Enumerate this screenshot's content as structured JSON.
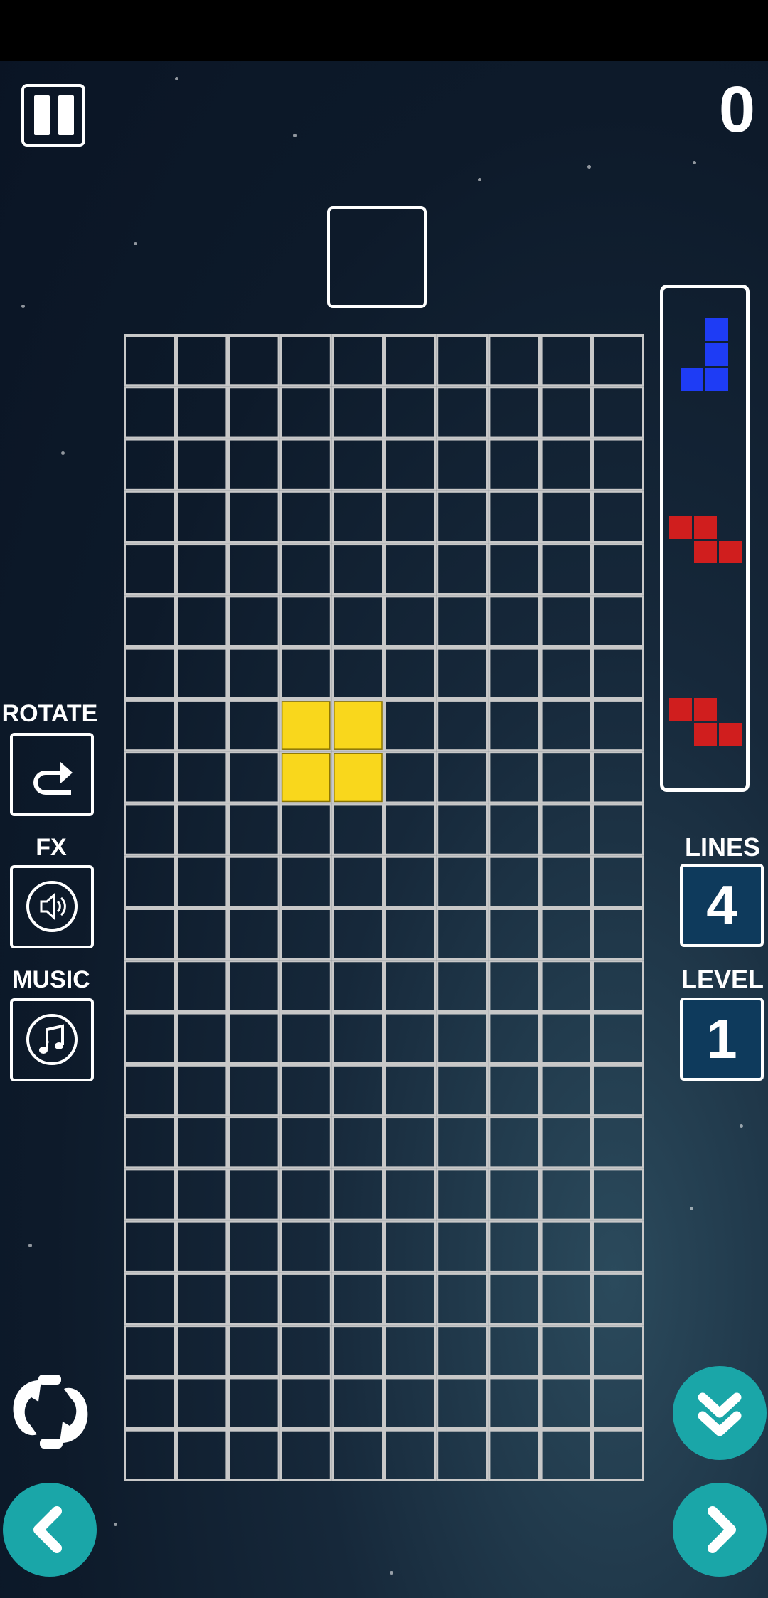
{
  "score": "0",
  "controls": {
    "rotate_label": "ROTATE",
    "fx_label": "FX",
    "music_label": "MUSIC"
  },
  "stats": {
    "lines_label": "LINES",
    "lines_value": "4",
    "level_label": "LEVEL",
    "level_value": "1"
  },
  "board": {
    "columns": 10,
    "rows": 22,
    "active_piece": {
      "type": "O",
      "color": "#f9d71c",
      "cells": [
        [
          3,
          7
        ],
        [
          4,
          7
        ],
        [
          3,
          8
        ],
        [
          4,
          8
        ]
      ]
    }
  },
  "next_pieces": [
    {
      "type": "J",
      "color": "#1e3cf5"
    },
    {
      "type": "Z",
      "color": "#d01e1e"
    },
    {
      "type": "Z",
      "color": "#d01e1e"
    }
  ],
  "colors": {
    "accent": "#1aa6a8",
    "stat_bg": "#0e3a5c",
    "grid": "#c8c8c8"
  },
  "icons": [
    "pause-icon",
    "rotate-arrow-icon",
    "speaker-icon",
    "music-note-icon",
    "rotate-device-icon",
    "hard-drop-icon",
    "left-arrow-icon",
    "right-arrow-icon"
  ]
}
